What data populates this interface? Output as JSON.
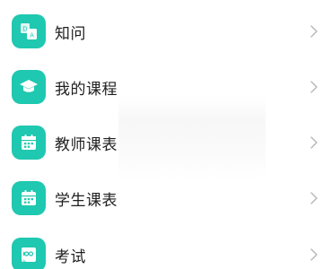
{
  "menu": {
    "items": [
      {
        "label": "知问",
        "icon": "translate-card-icon"
      },
      {
        "label": "我的课程",
        "icon": "graduation-cap-icon"
      },
      {
        "label": "教师课表",
        "icon": "calendar-icon"
      },
      {
        "label": "学生课表",
        "icon": "calendar-icon"
      },
      {
        "label": "考试",
        "icon": "exam-paper-icon"
      }
    ]
  },
  "colors": {
    "icon_bg": "#1fc8b0",
    "chevron": "#b5b5b5",
    "text": "#1f1f1f"
  }
}
